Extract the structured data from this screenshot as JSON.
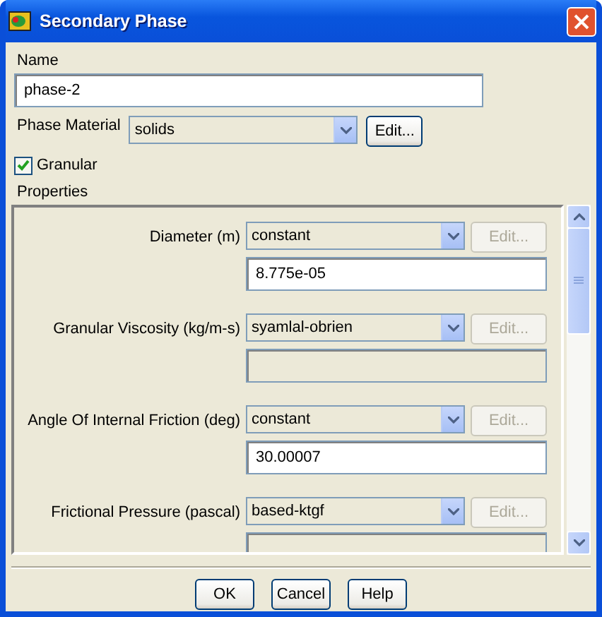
{
  "window": {
    "title": "Secondary Phase"
  },
  "name": {
    "label": "Name",
    "value": "phase-2"
  },
  "phase_material": {
    "label": "Phase Material",
    "value": "solids",
    "edit_button": {
      "label": "Edit...",
      "disabled": false
    }
  },
  "granular": {
    "label": "Granular",
    "checked": true
  },
  "properties": {
    "label": "Properties",
    "items": [
      {
        "label": "Diameter (m)",
        "method": "constant",
        "edit": {
          "label": "Edit...",
          "disabled": true
        },
        "field": {
          "value": "8.775e-05",
          "disabled": false
        }
      },
      {
        "label": "Granular Viscosity (kg/m-s)",
        "method": "syamlal-obrien",
        "edit": {
          "label": "Edit...",
          "disabled": true
        },
        "field": {
          "disabled": true
        }
      },
      {
        "label": "Angle Of Internal Friction (deg)",
        "method": "constant",
        "edit": {
          "label": "Edit...",
          "disabled": true
        },
        "field": {
          "value": "30.00007",
          "disabled": false
        }
      },
      {
        "label": "Frictional Pressure (pascal)",
        "method": "based-ktgf",
        "edit": {
          "label": "Edit...",
          "disabled": true
        },
        "field": {
          "disabled": true
        }
      }
    ]
  },
  "buttons": [
    {
      "label": "OK"
    },
    {
      "label": "Cancel"
    },
    {
      "label": "Help"
    }
  ]
}
